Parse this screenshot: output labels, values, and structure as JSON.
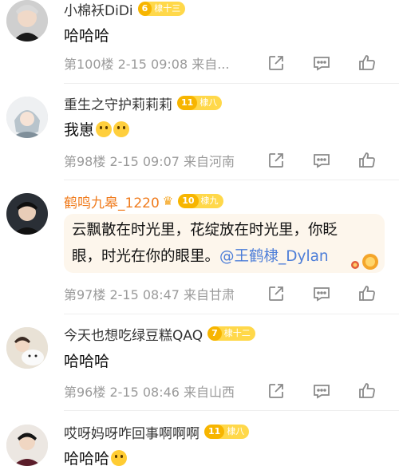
{
  "comments": [
    {
      "user": "小棉袄DiDi",
      "level": "6",
      "badge": "棣十三",
      "text": "哈哈哈",
      "meta": "第100楼 2-15 09:08 来自...",
      "time": "2-15 09:08",
      "floor": "第100楼"
    },
    {
      "user": "重生之守护莉莉莉",
      "level": "11",
      "badge": "棣八",
      "text": "我崽",
      "meta": "第98楼 2-15 09:07 来自河南"
    },
    {
      "user": "鹤鸣九皋_1220",
      "level": "10",
      "badge": "棣九",
      "quote_line1": "云飘散在时光里，花绽放在时光里，你眨",
      "quote_line2_a": "眼，时光在你的眼里。",
      "quote_mention": "@王鹤棣_Dylan",
      "meta": "第97楼 2-15 08:47 来自甘肃"
    },
    {
      "user": "今天也想吃绿豆糕QAQ",
      "level": "7",
      "badge": "棣十二",
      "text": "哈哈哈",
      "meta": "第96楼 2-15 08:46 来自山西"
    },
    {
      "user": "哎呀妈呀咋回事啊啊啊",
      "level": "11",
      "badge": "棣八",
      "text": "哈哈哈"
    }
  ],
  "colors": {
    "vip_name": "#f07c1e",
    "badge": "#ffd84a",
    "mention": "#4c7dd8",
    "meta": "#9a9a9a"
  },
  "icons": [
    "share-icon",
    "comment-icon",
    "like-icon"
  ]
}
